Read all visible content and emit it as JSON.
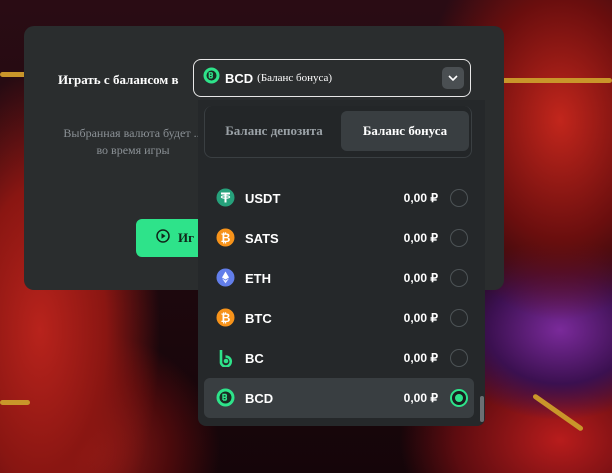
{
  "modal": {
    "balance_label": "Играть с балансом в",
    "selected": {
      "code": "BCD",
      "sub": "(Баланс бонуса)",
      "icon": "bcd-coin-icon"
    },
    "description": "Выбранная валюта будет ... во время игры",
    "play_button": "Иг"
  },
  "dropdown": {
    "tabs": [
      {
        "label": "Баланс депозита",
        "active": false
      },
      {
        "label": "Баланс бонуса",
        "active": true
      }
    ],
    "currencies": [
      {
        "code": "USDT",
        "amount": "0,00 ₽",
        "icon": "usdt-icon",
        "color": "#26a17b",
        "selected": false
      },
      {
        "code": "SATS",
        "amount": "0,00 ₽",
        "icon": "sats-icon",
        "color": "#f7931a",
        "selected": false
      },
      {
        "code": "ETH",
        "amount": "0,00 ₽",
        "icon": "eth-icon",
        "color": "#627eea",
        "selected": false
      },
      {
        "code": "BTC",
        "amount": "0,00 ₽",
        "icon": "btc-icon",
        "color": "#f7931a",
        "selected": false
      },
      {
        "code": "BC",
        "amount": "0,00 ₽",
        "icon": "bc-icon",
        "color": "#2ee38a",
        "selected": false
      },
      {
        "code": "BCD",
        "amount": "0,00 ₽",
        "icon": "bcd-icon",
        "color": "#2ee38a",
        "selected": true
      }
    ]
  },
  "colors": {
    "accent": "#2ee38a",
    "panel": "#2a2d2e",
    "dropdown": "#25282a"
  }
}
